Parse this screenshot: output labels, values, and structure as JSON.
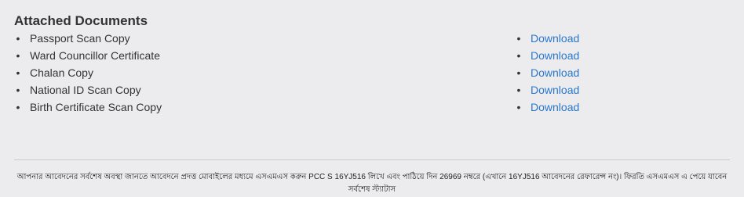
{
  "section": {
    "title": "Attached Documents"
  },
  "documents": [
    {
      "label": "Passport Scan Copy",
      "action": "Download"
    },
    {
      "label": "Ward Councillor Certificate",
      "action": "Download"
    },
    {
      "label": "Chalan Copy",
      "action": "Download"
    },
    {
      "label": "National ID Scan Copy",
      "action": "Download"
    },
    {
      "label": "Birth Certificate Scan Copy",
      "action": "Download"
    }
  ],
  "bullet": "•",
  "footer": {
    "note": "আপনার আবেদনের সর্বশেষ অবস্থা জানতে আবেদনে প্রদত্ত মোবাইলের মধ্যমে এসএমএস করুন PCC S 16YJ516 লিখে এবং পাঠিয়ে দিন 26969 নম্বরে (এখানে 16YJ516 আবেদনের রেফারেন্স নং)। ফিরতি এসএমএস এ পেয়ে যাবেন সর্বশেষ স্ট্যাটাস"
  },
  "colors": {
    "background": "#ececef",
    "text": "#333333",
    "link": "#2a77c9",
    "divider": "#c9c9cc"
  }
}
